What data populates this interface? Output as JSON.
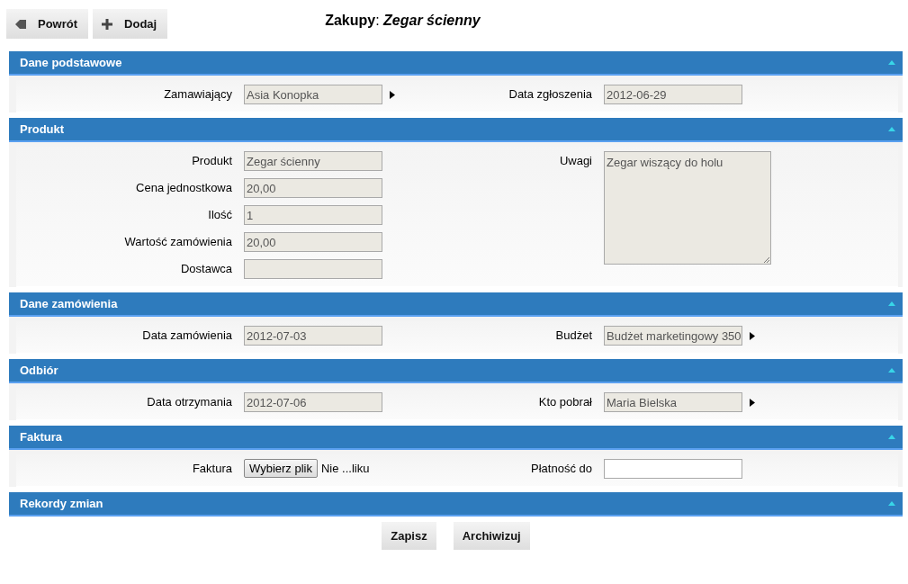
{
  "toolbar": [
    {
      "kind": "back",
      "label": "Powrót"
    },
    {
      "kind": "add",
      "label": "Dodaj"
    }
  ],
  "title": "**Zakupy**: *Zegar ścienny*",
  "sections": [
    {
      "title": "Dane podstawowe",
      "expanded": true,
      "columns": [
        [
          {
            "label": "Zamawiający",
            "kind": "readonly-link",
            "value": "Asia Konopka"
          }
        ],
        [
          {
            "label": "Data zgłoszenia",
            "kind": "readonly",
            "value": "2012-06-29"
          }
        ]
      ]
    },
    {
      "title": "Produkt",
      "expanded": true,
      "columns": [
        [
          {
            "label": "Produkt",
            "kind": "readonly",
            "value": "Zegar ścienny"
          },
          {
            "label": "Cena jednostkowa",
            "kind": "readonly",
            "value": "20,00"
          },
          {
            "label": "Ilość",
            "kind": "readonly",
            "value": "1"
          },
          {
            "label": "Wartość zamówienia",
            "kind": "readonly",
            "value": "20,00"
          },
          {
            "label": "Dostawca",
            "kind": "readonly"
          }
        ],
        [
          {
            "label": "Uwagi",
            "kind": "textarea",
            "value": "Zegar wiszący do holu"
          }
        ]
      ]
    },
    {
      "title": "Dane zamówienia",
      "expanded": true,
      "columns": [
        [
          {
            "label": "Data zamówienia",
            "kind": "readonly",
            "value": "2012-07-03"
          }
        ],
        [
          {
            "label": "Budżet",
            "kind": "readonly-link",
            "value": "Budżet marketingowy 350"
          }
        ]
      ]
    },
    {
      "title": "Odbiór",
      "expanded": true,
      "columns": [
        [
          {
            "label": "Data otrzymania",
            "kind": "readonly",
            "value": "2012-07-06"
          }
        ],
        [
          {
            "label": "Kto pobrał",
            "kind": "readonly-link",
            "value": "Maria Bielska"
          }
        ]
      ]
    },
    {
      "title": "Faktura",
      "expanded": true,
      "columns": [
        [
          {
            "label": "Faktura",
            "kind": "file",
            "button": "Wybierz plik",
            "value": "Nie ...liku"
          }
        ],
        [
          {
            "label": "Płatność do",
            "kind": "input"
          }
        ]
      ]
    },
    {
      "title": "Rekordy zmian",
      "expanded": true
    }
  ],
  "actions": [
    "Zapisz",
    "Archiwizuj"
  ]
}
